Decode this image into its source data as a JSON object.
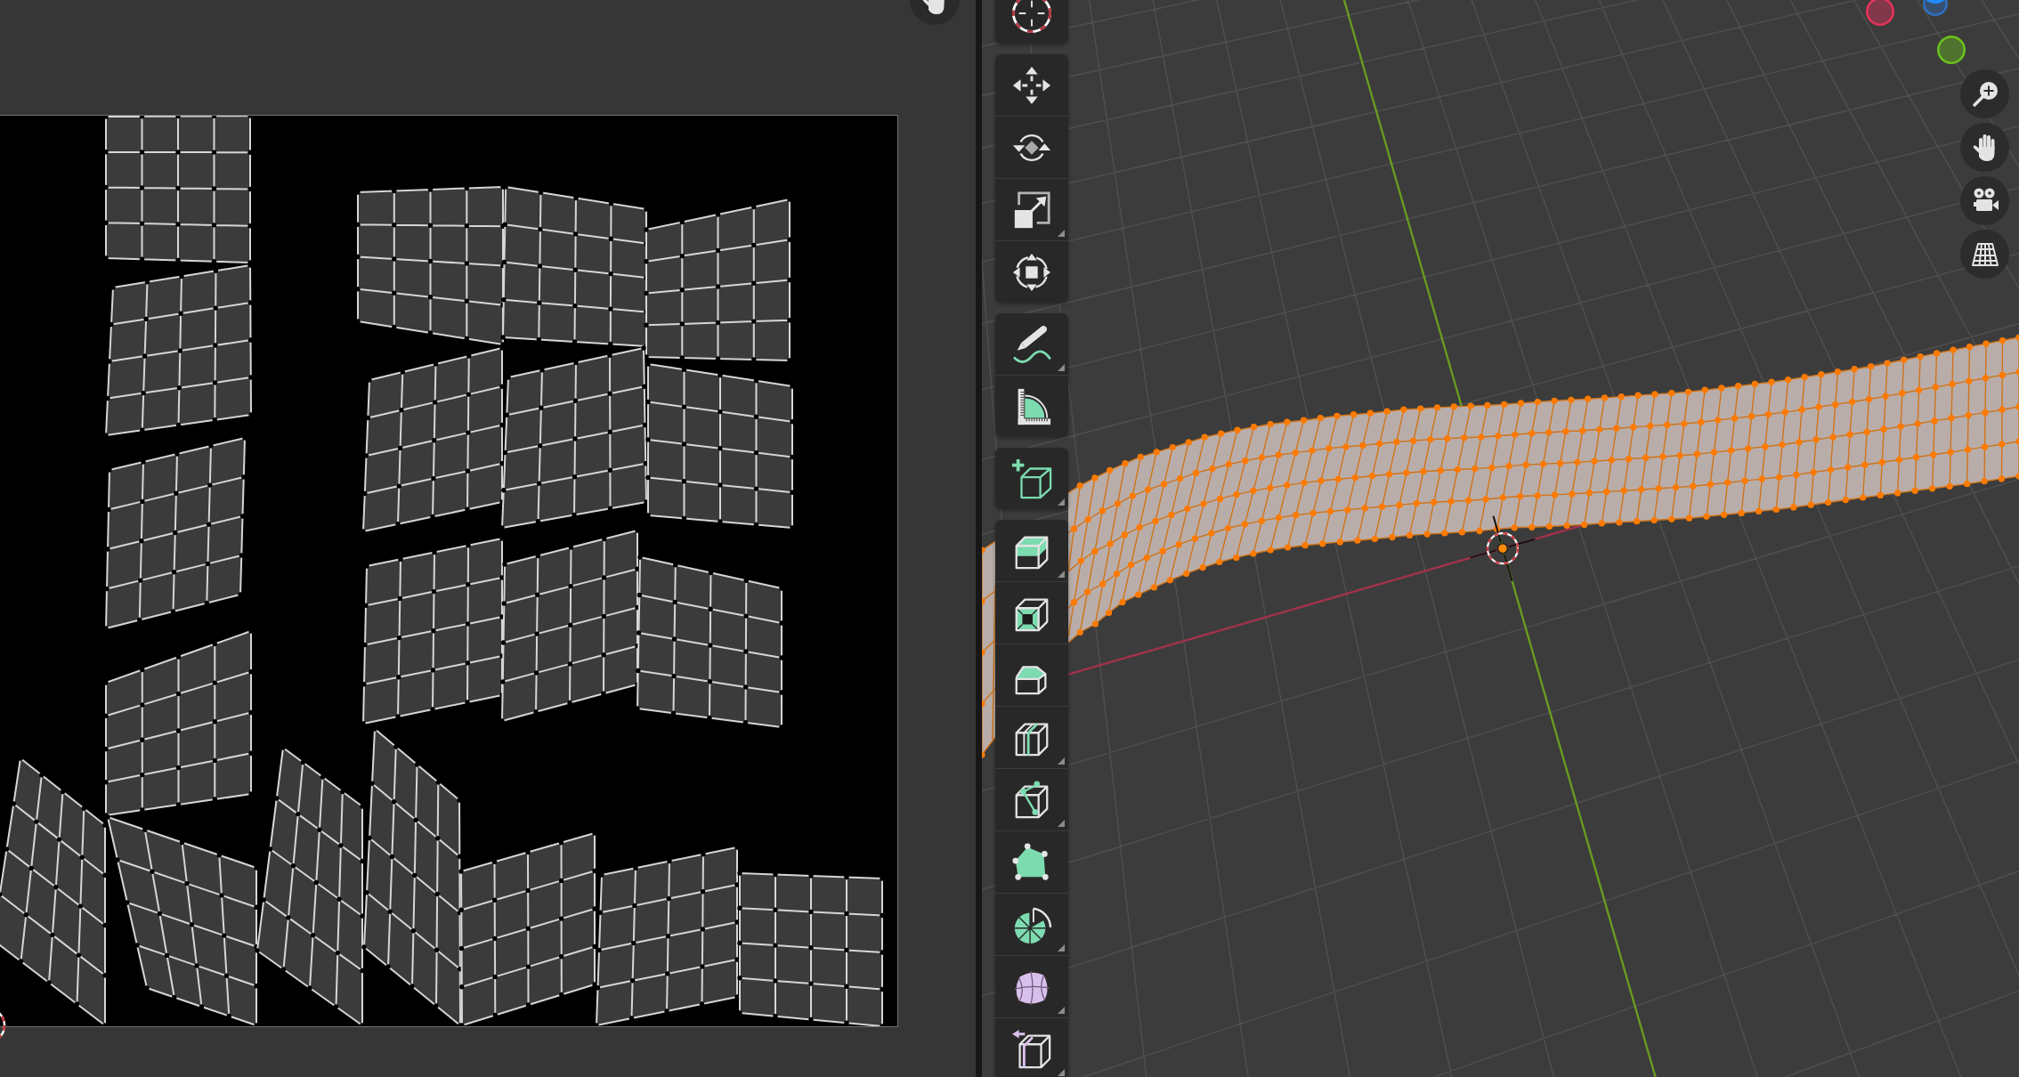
{
  "uv_editor": {
    "nav_buttons": [
      {
        "kind": "pan"
      }
    ]
  },
  "viewport": {
    "toolbar": [
      {
        "tools": [
          {
            "kind": "cursor",
            "selected": false,
            "submenu": false
          }
        ]
      },
      {
        "tools": [
          {
            "kind": "move",
            "selected": false,
            "submenu": false
          },
          {
            "kind": "rotate",
            "selected": false,
            "submenu": false
          },
          {
            "kind": "scale",
            "selected": false,
            "submenu": true
          },
          {
            "kind": "transform",
            "selected": false,
            "submenu": false
          }
        ]
      },
      {
        "tools": [
          {
            "kind": "annotate",
            "selected": false,
            "submenu": true
          },
          {
            "kind": "measure",
            "selected": false,
            "submenu": false
          }
        ]
      },
      {
        "tools": [
          {
            "kind": "add_cube",
            "selected": false,
            "submenu": true
          }
        ]
      },
      {
        "tools": [
          {
            "kind": "extrude",
            "selected": false,
            "submenu": true
          },
          {
            "kind": "inset",
            "selected": false,
            "submenu": false
          },
          {
            "kind": "bevel",
            "selected": false,
            "submenu": false
          },
          {
            "kind": "loop_cut",
            "selected": false,
            "submenu": true
          },
          {
            "kind": "knife",
            "selected": false,
            "submenu": true
          },
          {
            "kind": "poly_build",
            "selected": false,
            "submenu": false
          },
          {
            "kind": "spin",
            "selected": false,
            "submenu": true
          },
          {
            "kind": "smooth",
            "selected": false,
            "submenu": true
          },
          {
            "kind": "shrink_fatten",
            "selected": false,
            "submenu": true
          }
        ]
      }
    ],
    "axis_gizmo": [
      {
        "kind": "ring",
        "color": "#e8335c"
      },
      {
        "kind": "ring",
        "color": "#2f6fbf"
      },
      {
        "kind": "solid",
        "color": "#1f8bff"
      },
      {
        "kind": "ring",
        "color": "#6cc21c"
      }
    ],
    "nav_buttons": [
      {
        "kind": "zoom"
      },
      {
        "kind": "pan"
      },
      {
        "kind": "camera"
      },
      {
        "kind": "projection"
      }
    ],
    "mesh": {
      "selected": true
    }
  }
}
